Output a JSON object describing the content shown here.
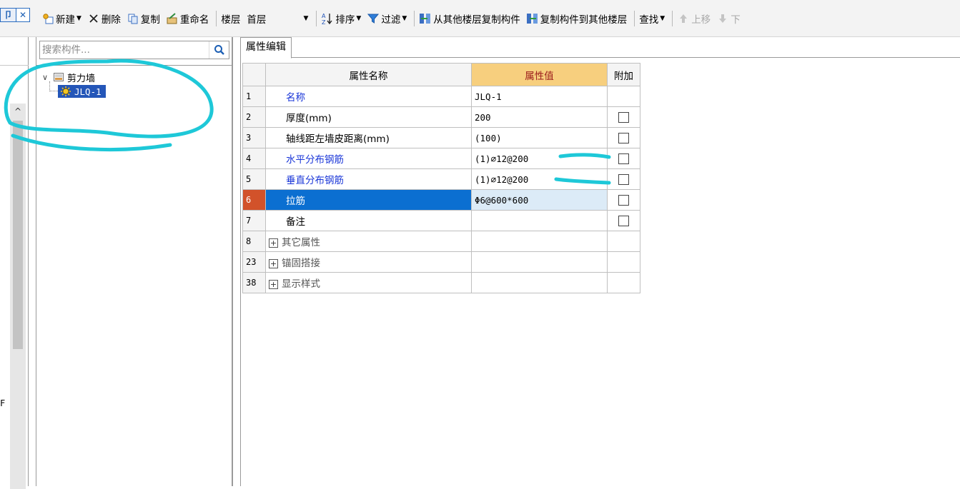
{
  "window_buttons": [
    "卩",
    "✕"
  ],
  "toolbar": {
    "new_label": "新建",
    "delete_label": "删除",
    "copy_label": "复制",
    "rename_label": "重命名",
    "floor_label": "楼层",
    "floor_value": "首层",
    "sort_label": "排序",
    "filter_label": "过滤",
    "copy_from_floor_label": "从其他楼层复制构件",
    "copy_to_floor_label": "复制构件到其他楼层",
    "find_label": "查找",
    "move_up_label": "上移",
    "move_down_label": "下"
  },
  "left_strip": {
    "letter": "F"
  },
  "tree": {
    "search_placeholder": "搜索构件...",
    "root_label": "剪力墙",
    "child_label": "JLQ-1"
  },
  "property_editor": {
    "tab_label": "属性编辑",
    "columns": {
      "name": "属性名称",
      "value": "属性值",
      "extra": "附加"
    },
    "rows": [
      {
        "num": "1",
        "name": "名称",
        "value": "JLQ-1",
        "checkbox": false
      },
      {
        "num": "2",
        "name": "厚度(mm)",
        "value": "200",
        "checkbox": true
      },
      {
        "num": "3",
        "name": "轴线距左墙皮距离(mm)",
        "value": "(100)",
        "checkbox": true
      },
      {
        "num": "4",
        "name": "水平分布钢筋",
        "value": "(1)⌀12@200",
        "checkbox": true
      },
      {
        "num": "5",
        "name": "垂直分布钢筋",
        "value": "(1)⌀12@200",
        "checkbox": true
      },
      {
        "num": "6",
        "name": "拉筋",
        "value": "Φ6@600*600",
        "checkbox": true
      },
      {
        "num": "7",
        "name": "备注",
        "value": "",
        "checkbox": true
      }
    ],
    "groups": [
      {
        "num": "8",
        "name": "其它属性"
      },
      {
        "num": "23",
        "name": "锚固搭接"
      },
      {
        "num": "38",
        "name": "显示样式"
      }
    ]
  },
  "colors": {
    "selection_blue": "#0b6fd1",
    "value_header": "#f7cf7e",
    "annotation": "#1ec8d8"
  }
}
